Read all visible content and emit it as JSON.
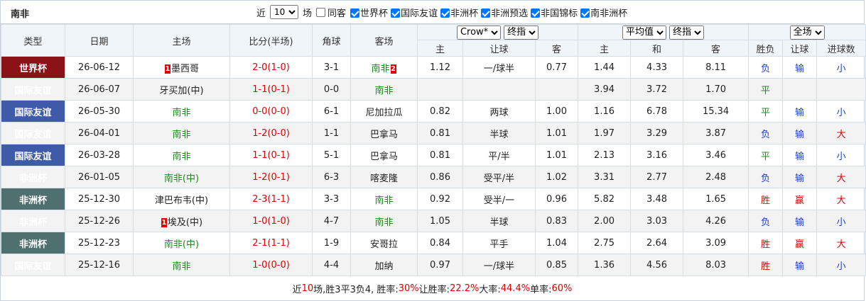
{
  "header": {
    "team": "南非",
    "recent_label": "近",
    "recent_value": "10",
    "recent_unit": "场",
    "same_home": "同客",
    "filters": [
      "世界杯",
      "国际友谊",
      "非洲杯",
      "非洲预选",
      "非国锦标",
      "南非洲杯"
    ]
  },
  "columns": {
    "type": "类型",
    "date": "日期",
    "home": "主场",
    "score": "比分(半场)",
    "corner": "角球",
    "away": "客场",
    "company": "Crow*",
    "handicap_mode": "终指",
    "avg": "平均值",
    "europe_mode": "终指",
    "scope": "全场",
    "sub_home": "主",
    "sub_hcp": "让球",
    "sub_away": "客",
    "sub_eh": "主",
    "sub_ed": "和",
    "sub_ea": "客",
    "res_wl": "胜负",
    "res_hcp": "让球",
    "res_ou": "进球数"
  },
  "rows": [
    {
      "type": "世界杯",
      "type_cls": "wc",
      "date": "26-06-12",
      "home_card": "1",
      "home": "墨西哥",
      "home_green": false,
      "score": "2-0(1-0)",
      "score_color": "red",
      "corner": "3-1",
      "away": "南非",
      "away_card": "2",
      "away_green": true,
      "o_home": "1.12",
      "o_hcp": "一/球半",
      "o_away": "0.77",
      "e_home": "1.44",
      "e_draw": "4.33",
      "e_away": "8.11",
      "r_wl": "负",
      "r_wl_c": "blue",
      "r_hcp": "输",
      "r_hcp_c": "blue",
      "r_ou": "小",
      "r_ou_c": "blue"
    },
    {
      "type": "国际友谊",
      "type_cls": "intl",
      "date": "26-06-07",
      "home_card": "",
      "home": "牙买加(中)",
      "home_green": false,
      "score": "1-1(0-1)",
      "score_color": "red",
      "corner": "0-0",
      "away": "南非",
      "away_card": "",
      "away_green": true,
      "o_home": "",
      "o_hcp": "",
      "o_away": "",
      "e_home": "3.94",
      "e_draw": "3.72",
      "e_away": "1.70",
      "r_wl": "平",
      "r_wl_c": "green",
      "r_hcp": "",
      "r_hcp_c": "blue",
      "r_ou": "",
      "r_ou_c": "blue"
    },
    {
      "type": "国际友谊",
      "type_cls": "intl",
      "date": "26-05-30",
      "home_card": "",
      "home": "南非",
      "home_green": true,
      "score": "0-0(0-0)",
      "score_color": "red",
      "corner": "6-1",
      "away": "尼加拉瓜",
      "away_card": "",
      "away_green": false,
      "o_home": "0.82",
      "o_hcp": "两球",
      "o_away": "1.00",
      "e_home": "1.16",
      "e_draw": "6.78",
      "e_away": "15.34",
      "r_wl": "平",
      "r_wl_c": "green",
      "r_hcp": "输",
      "r_hcp_c": "blue",
      "r_ou": "小",
      "r_ou_c": "blue"
    },
    {
      "type": "国际友谊",
      "type_cls": "intl",
      "date": "26-04-01",
      "home_card": "",
      "home": "南非",
      "home_green": true,
      "score": "1-2(0-0)",
      "score_color": "red",
      "corner": "1-1",
      "away": "巴拿马",
      "away_card": "",
      "away_green": false,
      "o_home": "0.81",
      "o_hcp": "半球",
      "o_away": "1.01",
      "e_home": "1.97",
      "e_draw": "3.29",
      "e_away": "3.87",
      "r_wl": "负",
      "r_wl_c": "blue",
      "r_hcp": "输",
      "r_hcp_c": "blue",
      "r_ou": "大",
      "r_ou_c": "red"
    },
    {
      "type": "国际友谊",
      "type_cls": "intl",
      "date": "26-03-28",
      "home_card": "",
      "home": "南非",
      "home_green": true,
      "score": "1-1(0-1)",
      "score_color": "red",
      "corner": "5-1",
      "away": "巴拿马",
      "away_card": "",
      "away_green": false,
      "o_home": "0.81",
      "o_hcp": "平/半",
      "o_away": "1.01",
      "e_home": "2.13",
      "e_draw": "3.16",
      "e_away": "3.46",
      "r_wl": "平",
      "r_wl_c": "green",
      "r_hcp": "输",
      "r_hcp_c": "blue",
      "r_ou": "小",
      "r_ou_c": "blue"
    },
    {
      "type": "非洲杯",
      "type_cls": "afcon",
      "date": "26-01-05",
      "home_card": "",
      "home": "南非(中)",
      "home_green": true,
      "score": "1-2(0-1)",
      "score_color": "red",
      "corner": "6-3",
      "away": "喀麦隆",
      "away_card": "",
      "away_green": false,
      "o_home": "0.86",
      "o_hcp": "受平/半",
      "o_away": "1.02",
      "e_home": "3.31",
      "e_draw": "2.77",
      "e_away": "2.48",
      "r_wl": "负",
      "r_wl_c": "blue",
      "r_hcp": "输",
      "r_hcp_c": "blue",
      "r_ou": "大",
      "r_ou_c": "red"
    },
    {
      "type": "非洲杯",
      "type_cls": "afcon",
      "date": "25-12-30",
      "home_card": "",
      "home": "津巴布韦(中)",
      "home_green": false,
      "score": "2-3(1-1)",
      "score_color": "red",
      "corner": "3-3",
      "away": "南非",
      "away_card": "",
      "away_green": true,
      "o_home": "0.92",
      "o_hcp": "受半/一",
      "o_away": "0.96",
      "e_home": "5.82",
      "e_draw": "3.48",
      "e_away": "1.65",
      "r_wl": "胜",
      "r_wl_c": "red",
      "r_hcp": "赢",
      "r_hcp_c": "red",
      "r_ou": "大",
      "r_ou_c": "red"
    },
    {
      "type": "非洲杯",
      "type_cls": "afcon",
      "date": "25-12-26",
      "home_card": "1",
      "home": "埃及(中)",
      "home_green": false,
      "score": "1-0(1-0)",
      "score_color": "red",
      "corner": "4-7",
      "away": "南非",
      "away_card": "",
      "away_green": true,
      "o_home": "1.05",
      "o_hcp": "半球",
      "o_away": "0.83",
      "e_home": "2.00",
      "e_draw": "3.03",
      "e_away": "4.26",
      "r_wl": "负",
      "r_wl_c": "blue",
      "r_hcp": "输",
      "r_hcp_c": "blue",
      "r_ou": "小",
      "r_ou_c": "blue"
    },
    {
      "type": "非洲杯",
      "type_cls": "afcon",
      "date": "25-12-23",
      "home_card": "",
      "home": "南非(中)",
      "home_green": true,
      "score": "2-1(1-1)",
      "score_color": "red",
      "corner": "1-9",
      "away": "安哥拉",
      "away_card": "",
      "away_green": false,
      "o_home": "0.84",
      "o_hcp": "平手",
      "o_away": "1.04",
      "e_home": "2.75",
      "e_draw": "2.64",
      "e_away": "3.09",
      "r_wl": "胜",
      "r_wl_c": "red",
      "r_hcp": "赢",
      "r_hcp_c": "red",
      "r_ou": "大",
      "r_ou_c": "red"
    },
    {
      "type": "国际友谊",
      "type_cls": "intl",
      "date": "25-12-16",
      "home_card": "",
      "home": "南非",
      "home_green": true,
      "score": "1-0(0-0)",
      "score_color": "red",
      "corner": "4-4",
      "away": "加纳",
      "away_card": "",
      "away_green": false,
      "o_home": "0.97",
      "o_hcp": "一/球半",
      "o_away": "0.85",
      "e_home": "1.36",
      "e_draw": "4.56",
      "e_away": "8.03",
      "r_wl": "胜",
      "r_wl_c": "red",
      "r_hcp": "输",
      "r_hcp_c": "blue",
      "r_ou": "小",
      "r_ou_c": "blue"
    }
  ],
  "summary": {
    "p1": "近",
    "games": "10",
    "p2": "场,胜3平3负4, 胜率:",
    "win_rate": "30%",
    "p3": " 让胜率:",
    "hcp_rate": "22.2%",
    "p4": " 大率:",
    "over_rate": "44.4%",
    "p5": " 单率:",
    "odd_rate": "60%"
  }
}
